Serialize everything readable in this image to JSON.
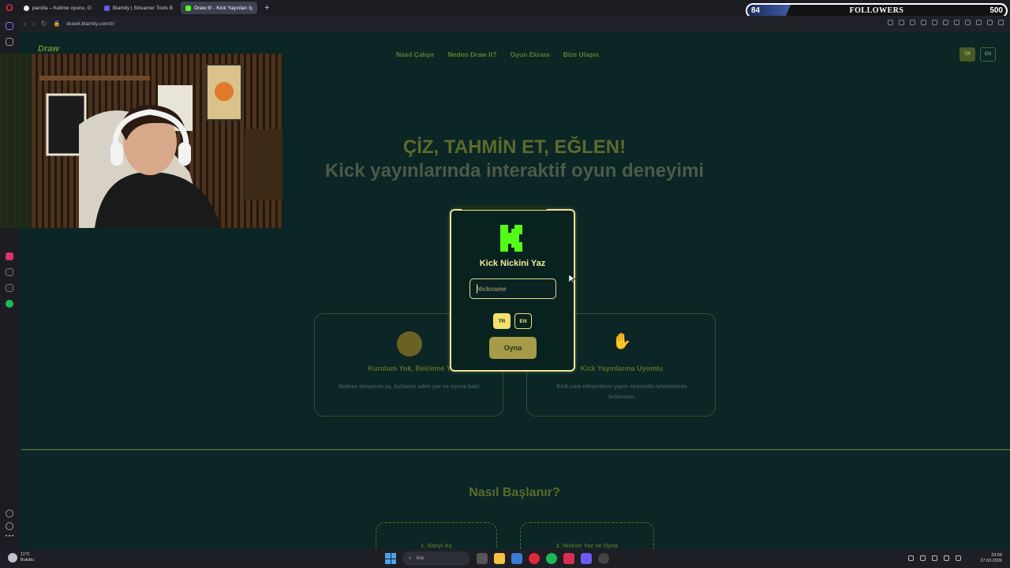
{
  "browser": {
    "tabs": [
      {
        "label": "parolla – Kelime oyunu, G",
        "active": false,
        "favicon_color": "#f0f0f0"
      },
      {
        "label": "Blamity | Streamer Tools B",
        "active": false,
        "favicon_color": "#5b5ef0"
      },
      {
        "label": "Draw It! - Kick Yayınları İç",
        "active": true,
        "favicon_color": "#53fc18"
      }
    ],
    "new_tab_label": "+",
    "url": "drawit.blamity.com/tr/"
  },
  "overlay": {
    "followers_label": "FOLLOWERS",
    "current": "84",
    "goal": "500",
    "progress": 0.168
  },
  "site": {
    "nav": [
      "Nasıl Çalışır",
      "Neden Draw It?",
      "Oyun Ekranı",
      "Bize Ulaşın"
    ],
    "lang_buttons": [
      "TR",
      "EN"
    ],
    "hero_title": "ÇİZ, TAHMİN ET, EĞLEN!",
    "hero_subtitle": "Kick yayınlarında interaktif oyun deneyimi",
    "features": [
      {
        "title": "Kurulum Yok, Bekleme Y",
        "desc": "Sadece tarayıcını aç, kullanıcı adını yaz ve oyuna katıl."
      },
      {
        "title": "Kick Yayınlarına Uyumlu",
        "desc": "Kick.com izleyicilerin yayın sırasında tahminlerde bulunsun."
      }
    ],
    "section_title": "Nasıl Başlanır?",
    "steps": [
      "1. Siteyi Aç",
      "2. Nickini Yaz ve Oyna"
    ]
  },
  "modal": {
    "title": "Kick Nickini Yaz",
    "input_placeholder": "Nickname",
    "input_value": "",
    "lang_tr": "TR",
    "lang_en": "EN",
    "play_label": "Oyna"
  },
  "taskbar": {
    "weather_temp": "11°C",
    "weather_desc": "Bulutlu",
    "search_placeholder": "Ara",
    "time": "23:59",
    "date": "27.03.2026"
  }
}
